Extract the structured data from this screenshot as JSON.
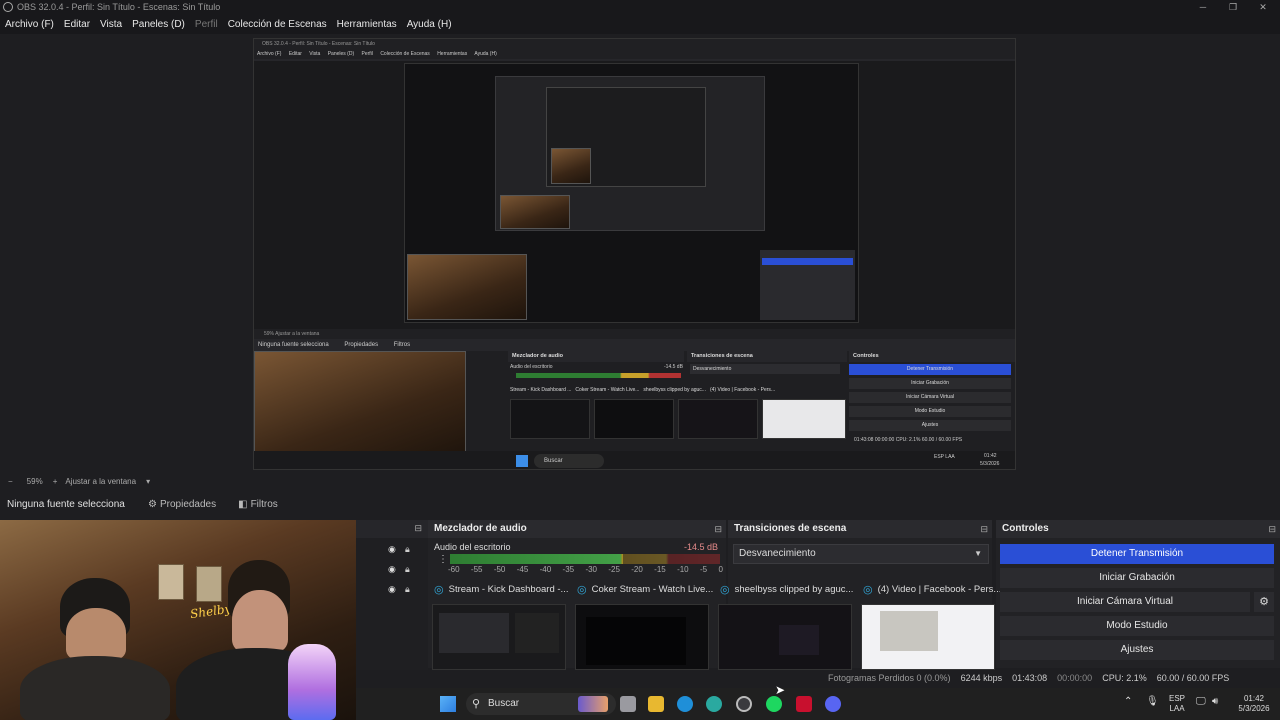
{
  "window": {
    "title": "OBS 32.0.4 - Perfil: Sin Título - Escenas: Sin Título",
    "controls": [
      "─",
      "❐",
      "✕"
    ]
  },
  "menu": {
    "items": [
      "Archivo (F)",
      "Editar",
      "Vista",
      "Paneles (D)",
      "Perfil",
      "Colección de Escenas",
      "Herramientas",
      "Ayuda (H)"
    ]
  },
  "nested": {
    "title": "OBS 32.0.4 - Perfil: Sin Título - Escenas: Sin Título",
    "menu": [
      "Archivo (F)",
      "Editar",
      "Vista",
      "Paneles (D)",
      "Perfil",
      "Colección de Escenas",
      "Herramientas",
      "Ayuda (H)"
    ],
    "zoom_bar": "59%   Ajustar a la ventana",
    "no_source": "Ninguna fuente selecciona",
    "properties": "Propiedades",
    "filters": "Filtros",
    "mixer_title": "Mezclador de audio",
    "transitions_title": "Transiciones de escena",
    "controls_title": "Controles",
    "controls": [
      "Detener Transmisión",
      "Iniciar Grabación",
      "Iniciar Cámara Virtual",
      "Modo Estudio",
      "Ajustes"
    ],
    "desktop_audio": "Audio del escritorio",
    "db": "-14.5 dB",
    "transition": "Desvanecimiento",
    "tabs": [
      "Stream - Kick Dashboard ...",
      "Coker Stream - Watch Live...",
      "sheelbyss clipped by aguc...",
      "(4) Video | Facebook - Pers..."
    ],
    "status": "01:43:08   00:00:00   CPU: 2.1%   60.00 / 60.00 FPS",
    "clock": "01:42",
    "date": "5/3/2026",
    "lang": "ESP LAA",
    "search": "Buscar"
  },
  "bottom": {
    "zoom_minus": "−",
    "zoom": "59%",
    "zoom_plus": "+",
    "fit": "Ajustar a la ventana"
  },
  "sourcebar": {
    "no_source": "Ninguna fuente selecciona",
    "properties": "Propiedades",
    "filters": "Filtros"
  },
  "webcam": {
    "neon": "Shelbys"
  },
  "mixer": {
    "title": "Mezclador de audio",
    "channel": "Audio del escritorio",
    "db": "-14.5 dB",
    "ticks": [
      "-60",
      "-55",
      "-50",
      "-45",
      "-40",
      "-35",
      "-30",
      "-25",
      "-20",
      "-15",
      "-10",
      "-5",
      "0"
    ],
    "level_fraction": 0.64
  },
  "transitions": {
    "title": "Transiciones de escena",
    "selected": "Desvanecimiento"
  },
  "controls": {
    "title": "Controles",
    "stop_stream": "Detener Transmisión",
    "start_recording": "Iniciar Grabación",
    "start_virtual_cam": "Iniciar Cámara Virtual",
    "studio_mode": "Modo Estudio",
    "settings": "Ajustes"
  },
  "tabs": [
    {
      "label": "Stream - Kick Dashboard -..."
    },
    {
      "label": "Coker Stream - Watch Live..."
    },
    {
      "label": "sheelbyss clipped by aguc..."
    },
    {
      "label": "(4) Video | Facebook - Pers..."
    }
  ],
  "status": {
    "dropped": "Fotogramas Perdidos 0 (0.0%)",
    "kbps": "6244 kbps",
    "live_time": "01:43:08",
    "rec_time": "00:00:00",
    "cpu": "CPU: 2.1%",
    "fps": "60.00 / 60.00 FPS"
  },
  "taskbar": {
    "search": "Buscar",
    "lang_top": "ESP",
    "lang_bottom": "LAA",
    "time": "01:42",
    "date": "5/3/2026"
  },
  "colors": {
    "accent": "#2a4fd6",
    "obs_link": "#31a7d8",
    "meter_green": "#43a047",
    "meter_yellow": "#c7a02a",
    "meter_red": "#b23232"
  }
}
